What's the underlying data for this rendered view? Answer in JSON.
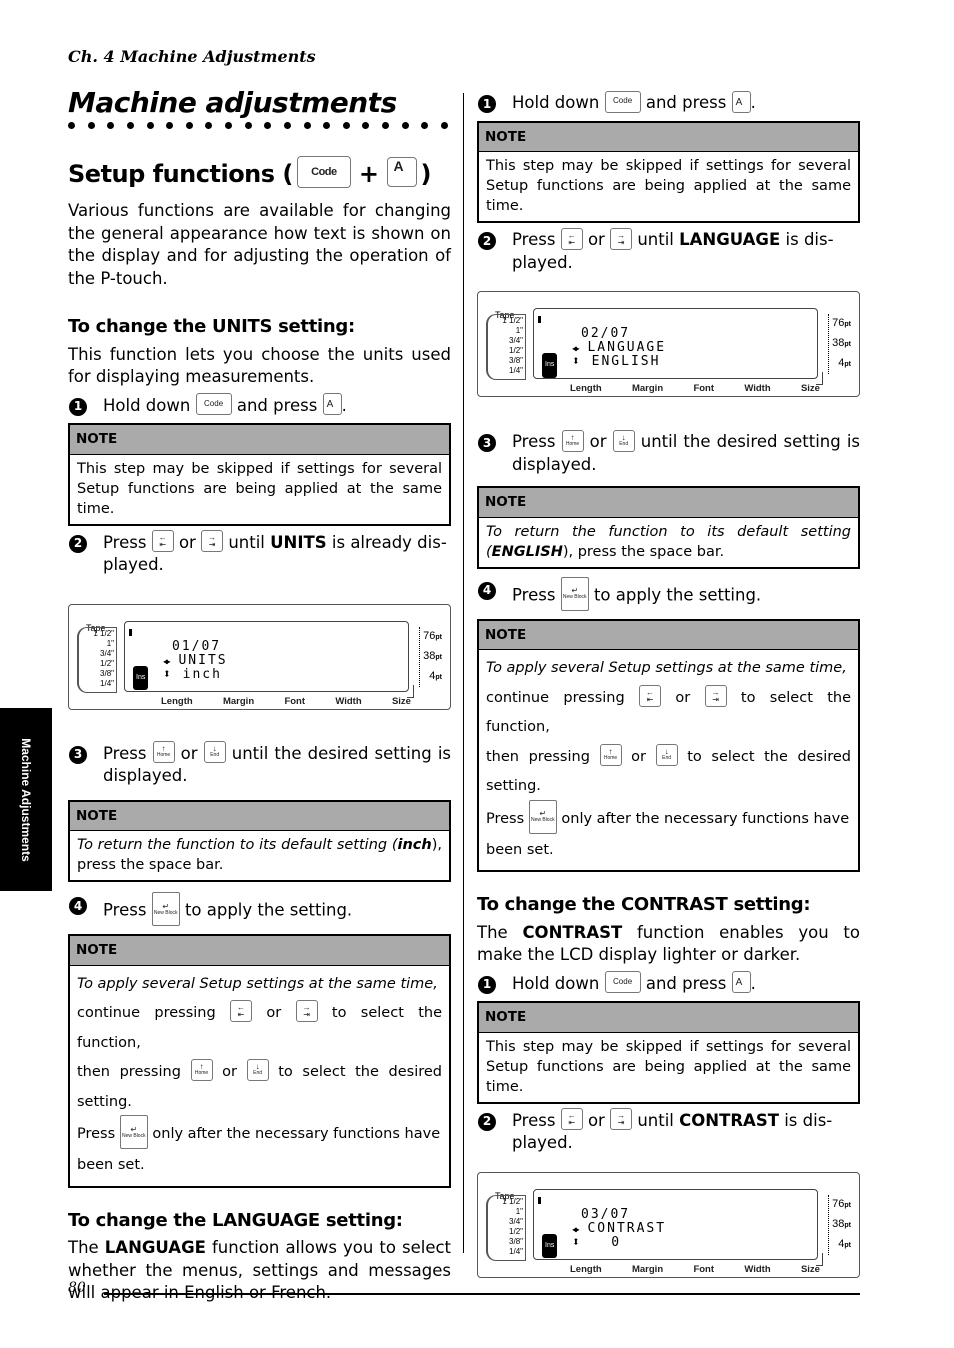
{
  "header": {
    "chapter": "Ch. 4 Machine Adjustments"
  },
  "title": "Machine adjustments",
  "section": {
    "heading": "Setup functions (",
    "plus": "+",
    "close": ")",
    "keys": {
      "code": "Code",
      "a": "A"
    },
    "intro": "Various functions are available for changing the general appearance how text is shown on the display and for adjusting the operation of the P-touch."
  },
  "keys": {
    "code": "Code",
    "a": "A",
    "left_glyph": "←",
    "left_sub": "⇤",
    "right_glyph": "→",
    "right_sub": "⇥",
    "home_glyph": "↑",
    "home_sub": "Home",
    "end_glyph": "↓",
    "end_sub": "End",
    "newblock_glyph": "↵",
    "newblock_sub": "New Block"
  },
  "common": {
    "hold_down": "Hold down",
    "and_press": "and press",
    "period": ".",
    "press": "Press",
    "or": "or",
    "until": "until",
    "is_disp": "is dis-",
    "played": "played.",
    "until_desired": "until the desired setting is displayed.",
    "to_apply": "to apply the setting.",
    "note": "NOTE",
    "skip_note": "This step may be skipped if settings for several Setup functions are being applied at the same time.",
    "several_1": "To apply several Setup settings at the same time,",
    "several_2a": "continue pressing",
    "several_2b": "to select the function,",
    "several_3a": "then pressing",
    "several_3b": "to select the desired setting.",
    "several_4b": "only after the necessary functions have",
    "several_5": "been set.",
    "default_a": "To return the function to its default setting (",
    "default_b": "), press the space bar."
  },
  "units": {
    "heading": "To change the UNITS setting:",
    "desc": "This function lets you choose the units used for displaying measurements.",
    "step2_word": "UNITS",
    "step2_tail": "is already dis-",
    "default_value": "inch",
    "lcd": {
      "line1": "01/07",
      "line2": "UNITS",
      "line3": "inch"
    }
  },
  "language": {
    "heading": "To change the LANGUAGE setting:",
    "desc_a": "The",
    "desc_word": "LANGUAGE",
    "desc_b": "function allows you to select whether the menus, settings and messages will appear in English or French.",
    "step2_word": "LANGUAGE",
    "default_value": "ENGLISH",
    "lcd": {
      "line1": "02/07",
      "line2": "LANGUAGE",
      "line3": "ENGLISH"
    }
  },
  "contrast": {
    "heading": "To change the CONTRAST setting:",
    "desc_a": "The",
    "desc_word": "CONTRAST",
    "desc_b": "function enables you to make the LCD display lighter or darker.",
    "step2_word": "CONTRAST",
    "lcd": {
      "line1": "03/07",
      "line2": "CONTRAST",
      "line3": "  0"
    }
  },
  "lcd_common": {
    "tape_label": "Tape",
    "tape_sizes": [
      "1 1/2\"",
      "1\"",
      "3/4\"",
      "1/2\"",
      "3/8\"",
      "1/4\""
    ],
    "ins": "Ins",
    "lr_arrow": "◀▶",
    "ud_arrow": "⬍",
    "bottom_labels": [
      "Length",
      "Margin",
      "Font",
      "Width",
      "Size"
    ],
    "pts": [
      {
        "v": "76",
        "u": "pt"
      },
      {
        "v": "38",
        "u": "pt"
      },
      {
        "v": "4",
        "u": "pt"
      }
    ]
  },
  "step_numbers": [
    "1",
    "2",
    "3",
    "4"
  ],
  "side_tab": "Machine Adjustments",
  "footer": {
    "page_number": "80"
  }
}
